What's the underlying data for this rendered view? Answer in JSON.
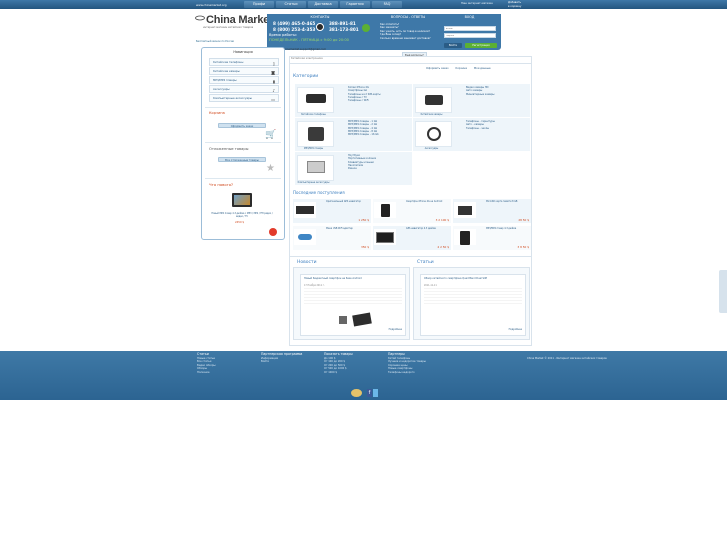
{
  "top": {
    "site_url": "www.chinamarket.org",
    "nav": [
      "Профи",
      "Статьи",
      "Доставка",
      "Гарантия",
      "FAQ"
    ],
    "language_link": "Наш интернет-магазин",
    "basket_title": "Добавить",
    "basket_sub": "в корзину"
  },
  "logo": {
    "name": "China Market",
    "tagline": "интернет-магазин китайских товаров"
  },
  "free_call": "Бесплатный звонок по России",
  "contacts": {
    "title": "КОНТАКТЫ",
    "phones": [
      "8 (499) 465-0-465",
      "8 (800) 253-4-353"
    ],
    "phones2": [
      "388-891-81",
      "381-173-801"
    ],
    "hours_label": "Время работы:",
    "hours": "ПОНЕДЕЛЬНИК - ПЯТНИЦА с 9:00 до 20:00",
    "email": "chinamarket.support@gmail.com"
  },
  "faq": {
    "title": "ВОПРОСЫ - ОТВЕТЫ",
    "items": [
      "Как оплатить?",
      "Как заказать?",
      "Как узнать, есть ли товар в наличии?",
      "Где Ваш склад?",
      "Сколько времени занимает доставка?"
    ]
  },
  "login": {
    "title": "ВХОД",
    "email_placeholder": "E-mail",
    "password_placeholder": "Пароль",
    "login_button": "Войти",
    "register_button": "Регистрация"
  },
  "question_button": "Ещё вопросы?",
  "sidebar": {
    "nav_title": "Навигация",
    "items": [
      {
        "label": "Китайские телефоны",
        "icon": "phone-icon"
      },
      {
        "label": "Китайские камеры",
        "icon": "camera-icon"
      },
      {
        "label": "MP3/MP4 плееры",
        "icon": "player-icon"
      },
      {
        "label": "Аксессуары",
        "icon": "accessory-icon"
      },
      {
        "label": "Компьютерные аксессуары",
        "icon": "laptop-icon"
      }
    ],
    "cart_title": "Корзина",
    "cart_button": "Оформить заказ",
    "deferred_title": "Отложенные товары",
    "deferred_button": "Все отложенные товары",
    "new_title": "Что нового?",
    "new_text": "Новый MP4 плеер 4.3 дюйма с MP3 / MP4 / FM радио / видео / TV",
    "new_price": "2450 $"
  },
  "main": {
    "breadcrumb": "Китайская электроника",
    "toolbar": [
      "Оформить заказ",
      "Корзина",
      "Мои данные"
    ],
    "categories_title": "Категории",
    "categories": [
      {
        "name": "Китайские телефоны",
        "links": [
          "Копии iPhone 4G",
          "Смартфоны GA",
          "Телефоны на 2 SIM-карты",
          "Телефоны с TV",
          "Телефоны с WiFi"
        ]
      },
      {
        "name": "Китайские камеры",
        "links": [
          "Видео камеры HD",
          "Авто камеры",
          "Миниатюрные камеры"
        ]
      },
      {
        "name": "MP3/MP4 плееры",
        "links": [
          "MP3/MP4 плееры - 1 Gb",
          "MP3/MP4 плееры - 2 Gb",
          "MP3/MP4 плееры - 4 Gb",
          "MP3/MP4 плееры - 8 Gb",
          "MP3/MP4 плееры - 16 Gb"
        ]
      },
      {
        "name": "Аксессуары",
        "links": [
          "Телефоны - гарнитуры",
          "Авто - камеры",
          "Телефоны - чехлы"
        ]
      },
      {
        "name": "Компьютерные аксессуары",
        "links": [
          "Ноутбуки",
          "Портативные колонки",
          "Клавиатуры и мыши",
          "Накопители",
          "Разное"
        ]
      }
    ],
    "latest_title": "Последние поступления",
    "products": [
      {
        "text": "Оригинальный GPS навигатор",
        "price": "1 250 $"
      },
      {
        "text": "Смартфон iPhone 4G на Android",
        "price": "3 2 100 $"
      },
      {
        "text": "MicroSD карта памяти 8 GB",
        "price": "28 50 $"
      },
      {
        "text": "Мини USB WiFi адаптер",
        "price": "350 $"
      },
      {
        "text": "GPS навигатор 4.3 дюйма",
        "price": "4 2 50 $"
      },
      {
        "text": "MP3/MP4 плеер 4.3 дюйма",
        "price": "3 8 50 $"
      }
    ],
    "news_title": "Новости",
    "news_headline": "Новый бюджетный смартфон на базе Android",
    "news_date": "17 Ноября 2011 г.",
    "news_link": "Подробнее",
    "articles_title": "Статьи",
    "article_headline": "Обзор китайского смартфона Quad Band Dual SIM",
    "article_date": "2011-11-11",
    "article_link": "Подробнее"
  },
  "footer": {
    "columns": [
      {
        "title": "Статьи",
        "links": [
          "Новые статьи",
          "Все статьи",
          "Видео обзоры",
          "Обзоры",
          "Полезное"
        ]
      },
      {
        "title": "Партнерская программа",
        "links": [
          "Информация",
          "Войти"
        ]
      },
      {
        "title": "Показать товары",
        "links": [
          "До 100 $",
          "От 100 до 200 $",
          "От 200 до 500 $",
          "От 500 до 1000 $",
          "От 1000 $"
        ]
      },
      {
        "title": "Партнеры",
        "links": [
          "Китай телефоны",
          "Лучшие и недорогие товары",
          "Хорошие цены",
          "Новые смартфоны",
          "Телефоны недорого"
        ]
      }
    ],
    "copyright": "China Market © 2011 - Интернет магазин китайских товаров"
  },
  "colors": {
    "accent": "#3e78a8",
    "link": "#2a5c86",
    "price": "#d0481c",
    "green": "#5bb033"
  }
}
